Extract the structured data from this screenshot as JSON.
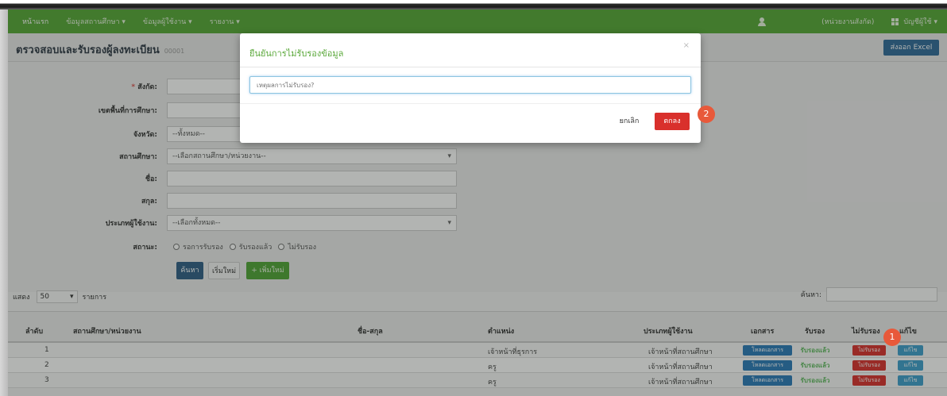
{
  "nav": {
    "items": [
      "หน้าแรก",
      "ข้อมูลสถานศึกษา ▾",
      "ข้อมูลผู้ใช้งาน ▾",
      "รายงาน ▾"
    ],
    "org": "(หน่วยงานสังกัด)",
    "account": "บัญชีผู้ใช้ ▾"
  },
  "page": {
    "title": "ตรวจสอบและรับรองผู้ลงทะเบียน",
    "subtitle": "00001",
    "export_label": "ส่งออก Excel"
  },
  "form": {
    "labels": {
      "affiliation": "สังกัด:",
      "area": "เขตพื้นที่การศึกษา:",
      "province": "จังหวัด:",
      "school": "สถานศึกษา:",
      "first_name": "ชื่อ:",
      "last_name": "สกุล:",
      "user_type": "ประเภทผู้ใช้งาน:",
      "status": "สถานะ:"
    },
    "required_mark": "*",
    "province_value": "--ทั้งหมด--",
    "school_value": "--เลือกสถานศึกษา/หน่วยงาน--",
    "user_type_value": "--เลือกทั้งหมด--",
    "status_options": [
      "รอการรับรอง",
      "รับรองแล้ว",
      "ไม่รับรอง"
    ],
    "search_label": "ค้นหา",
    "reset_label": "เริ่มใหม่",
    "add_label": "+ เพิ่มใหม่"
  },
  "table": {
    "show_label": "แสดง",
    "page_size": "50",
    "records_label": "รายการ",
    "search_label": "ค้นหา:",
    "columns": [
      "ลำดับ",
      "สถานศึกษา/หน่วยงาน",
      "ชื่อ-สกุล",
      "ตำแหน่ง",
      "ประเภทผู้ใช้งาน",
      "เอกสาร",
      "รับรอง",
      "ไม่รับรอง",
      "แก้ไข"
    ],
    "rows": [
      {
        "no": "1",
        "position": "เจ้าหน้าที่ธุรการ",
        "type": "เจ้าหน้าที่สถานศึกษา",
        "doc": "โหลดเอกสาร",
        "approve": "รับรองแล้ว",
        "reject": "ไม่รับรอง",
        "edit": "แก้ไข"
      },
      {
        "no": "2",
        "position": "ครู",
        "type": "เจ้าหน้าที่สถานศึกษา",
        "doc": "โหลดเอกสาร",
        "approve": "รับรองแล้ว",
        "reject": "ไม่รับรอง",
        "edit": "แก้ไข"
      },
      {
        "no": "3",
        "position": "ครู",
        "type": "เจ้าหน้าที่สถานศึกษา",
        "doc": "โหลดเอกสาร",
        "approve": "รับรองแล้ว",
        "reject": "ไม่รับรอง",
        "edit": "แก้ไข"
      }
    ]
  },
  "modal": {
    "title": "ยืนยันการไม่รับรองข้อมูล",
    "close": "×",
    "reason_placeholder": "เหตุผลการไม่รับรอง?",
    "cancel_label": "ยกเลิก",
    "ok_label": "ตกลง"
  },
  "markers": {
    "first": "1",
    "second": "2"
  },
  "colors": {
    "navbar": "#55a736",
    "modal_title": "#5aa83a",
    "ok_button": "#d9302c",
    "marker": "#e8593a"
  }
}
